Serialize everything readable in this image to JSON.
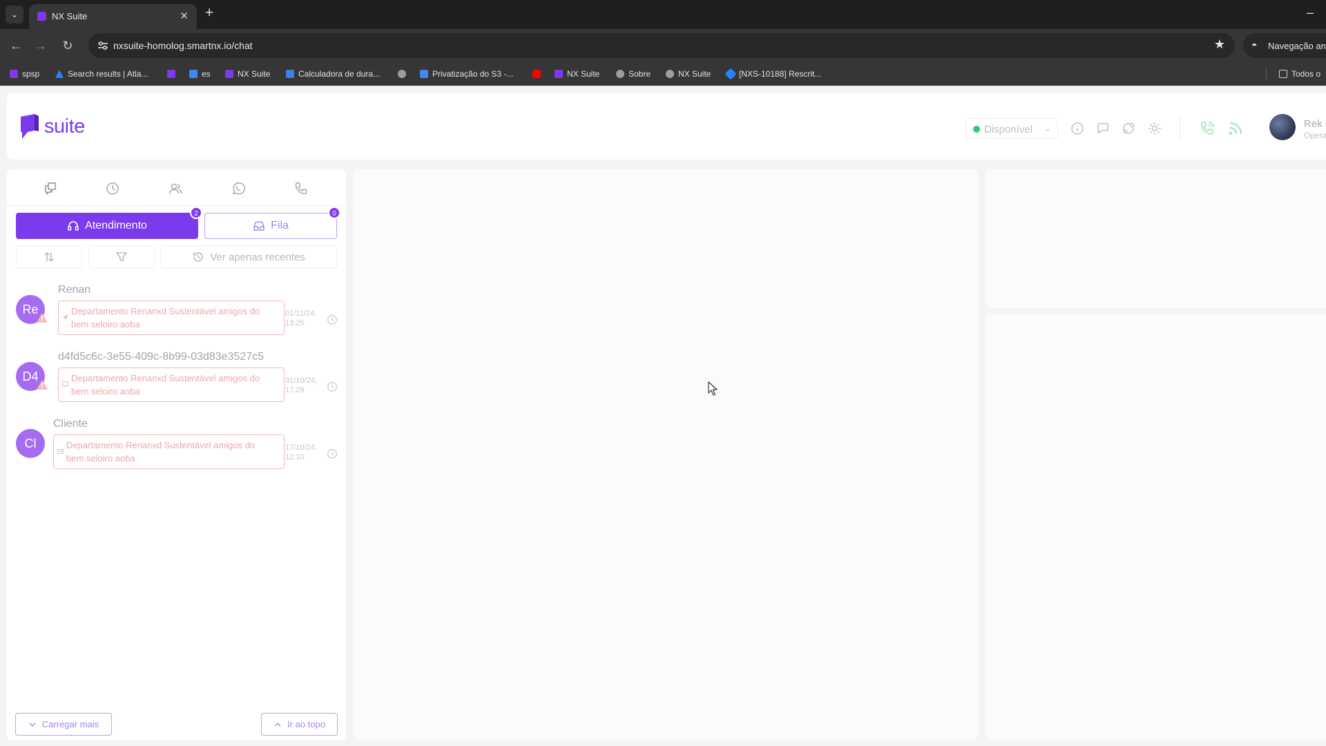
{
  "browser": {
    "tab": {
      "title": "NX Suite",
      "close": "✕"
    },
    "url": "nxsuite-homolog.smartnx.io/chat",
    "incognito_label": "Navegação anô",
    "bookmarks": [
      {
        "label": "spsp",
        "color": "#7c3aed"
      },
      {
        "label": "Search results | Atla...",
        "color": "#2684ff"
      },
      {
        "label": "",
        "color": "#7c3aed"
      },
      {
        "label": "es",
        "color": "#4285f4"
      },
      {
        "label": "NX Suite",
        "color": "#7c3aed"
      },
      {
        "label": "Calculadora de dura...",
        "color": "#3f7ee8"
      },
      {
        "label": "",
        "color": "#9e9e9e"
      },
      {
        "label": "Privatização do S3 -...",
        "color": "#4285f4"
      },
      {
        "label": "",
        "color": "#ff0000"
      },
      {
        "label": "NX Suite",
        "color": "#7c3aed"
      },
      {
        "label": "Sobre",
        "color": "#9e9e9e"
      },
      {
        "label": "NX Suite",
        "color": "#9e9e9e"
      },
      {
        "label": "[NXS-10188] Rescrit...",
        "color": "#2684ff"
      }
    ],
    "all_bookmarks_label": "Todos o"
  },
  "app": {
    "logo_text": "suite",
    "brand_color": "#7c3aed",
    "status": {
      "label": "Disponível",
      "color": "#2ecc71"
    },
    "user": {
      "name": "Rek s",
      "role": "Opera"
    },
    "header_icons": [
      "info-icon",
      "chat-icon",
      "share-icon",
      "theme-sun-icon",
      "phone-call-icon",
      "rss-icon"
    ],
    "nav_icons": [
      "chat-bubbles-icon",
      "clock-icon",
      "contacts-icon",
      "whatsapp-icon",
      "phone-icon"
    ],
    "tabs": {
      "atendimento": {
        "label": "Atendimento",
        "badge": "2"
      },
      "fila": {
        "label": "Fila",
        "badge": "0"
      }
    },
    "filters": {
      "recent_label": "Ver apenas recentes"
    },
    "conversations": [
      {
        "initials": "Re",
        "name": "Renan",
        "tag": "Departamento Renanxd Sustentável amigos do bem seloiro aoba",
        "date": "01/11/24,",
        "time": "13:25"
      },
      {
        "initials": "D4",
        "name": "d4fd5c6c-3e55-409c-8b99-03d83e3527c5",
        "tag": "Departamento Renanxd Sustentável amigos do bem seloiro aoba",
        "date": "31/10/24,",
        "time": "17:29"
      },
      {
        "initials": "Cl",
        "name": "Cliente",
        "tag": "Departamento Renanxd Sustentável amigos do bem seloiro aoba",
        "date": "17/10/24,",
        "time": "12:10"
      }
    ],
    "footer": {
      "load_more": "Carregar mais",
      "go_top": "Ir ao topo"
    }
  }
}
